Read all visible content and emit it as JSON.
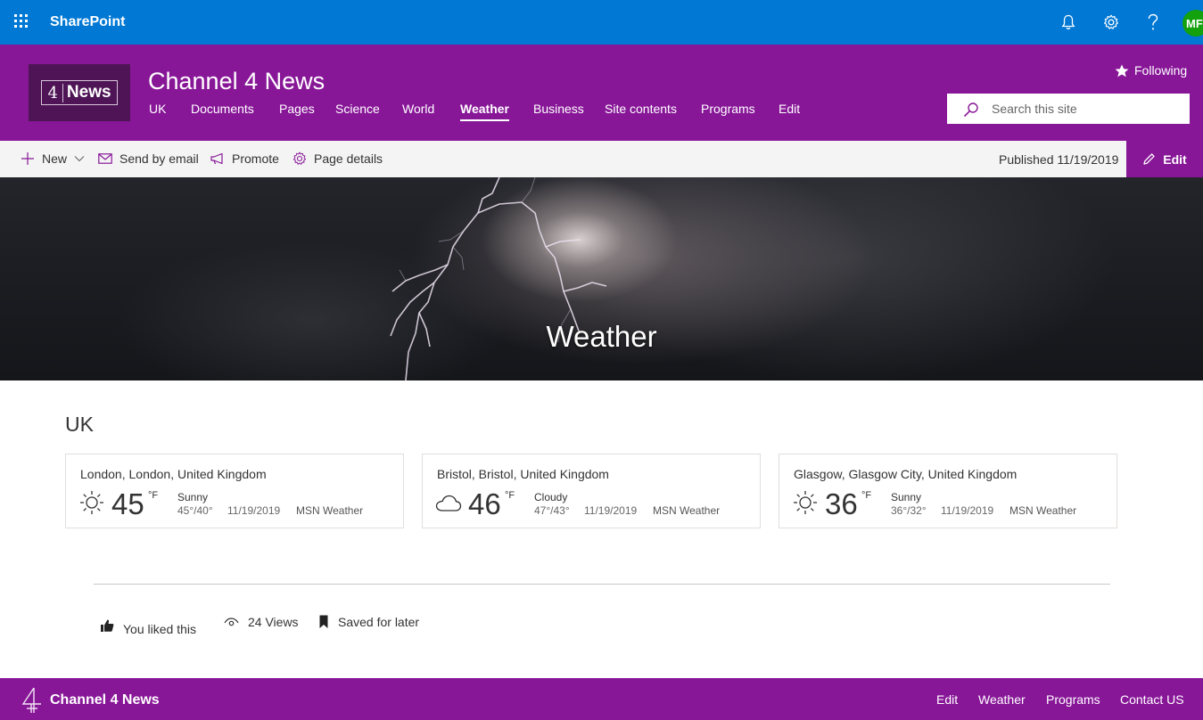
{
  "suite_bar": {
    "brand": "SharePoint",
    "avatar_initials": "MF",
    "icons": [
      "app-launcher-icon",
      "bell-icon",
      "gear-icon",
      "help-icon"
    ]
  },
  "site": {
    "logo_number": "4",
    "logo_text": "News",
    "title": "Channel 4 News",
    "following_label": "Following",
    "nav": [
      "UK",
      "Documents",
      "Pages",
      "Science",
      "World",
      "Weather",
      "Business",
      "Site contents",
      "Programs",
      "Edit"
    ],
    "active_nav": "Weather",
    "search_placeholder": "Search this site"
  },
  "command_bar": {
    "new_label": "New",
    "email_label": "Send by email",
    "promote_label": "Promote",
    "details_label": "Page details",
    "published": "Published 11/19/2019",
    "edit_label": "Edit"
  },
  "hero": {
    "title": "Weather"
  },
  "weather": {
    "heading": "UK",
    "cards": [
      {
        "location": "London, London, United Kingdom",
        "icon": "sun-icon",
        "temp": "45",
        "unit": "°F",
        "condition": "Sunny",
        "range": "45°/40°",
        "date": "11/19/2019",
        "source": "MSN Weather"
      },
      {
        "location": "Bristol, Bristol, United Kingdom",
        "icon": "cloud-icon",
        "temp": "46",
        "unit": "°F",
        "condition": "Cloudy",
        "range": "47°/43°",
        "date": "11/19/2019",
        "source": "MSN Weather"
      },
      {
        "location": "Glasgow, Glasgow City, United Kingdom",
        "icon": "sun-icon",
        "temp": "36",
        "unit": "°F",
        "condition": "Sunny",
        "range": "36°/32°",
        "date": "11/19/2019",
        "source": "MSN Weather"
      }
    ]
  },
  "social": {
    "liked": "You liked this",
    "views": "24 Views",
    "saved": "Saved for later"
  },
  "footer": {
    "title": "Channel 4 News",
    "links": [
      "Edit",
      "Weather",
      "Programs",
      "Contact US"
    ]
  },
  "colors": {
    "suite_bar": "#0078d4",
    "theme": "#881798",
    "avatar": "#13a10e"
  }
}
